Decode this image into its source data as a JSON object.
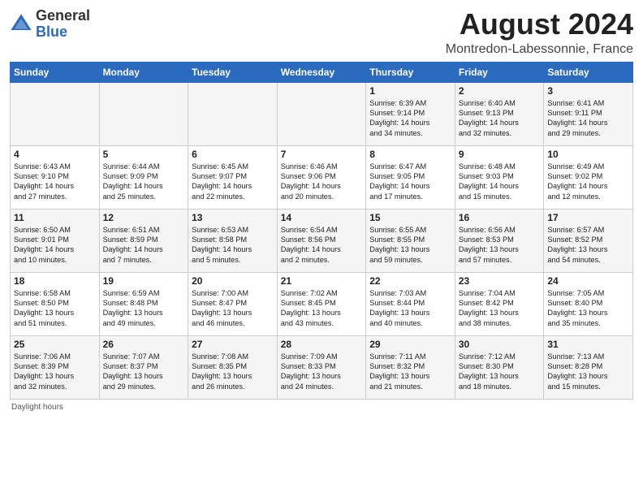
{
  "header": {
    "logo_general": "General",
    "logo_blue": "Blue",
    "title": "August 2024",
    "subtitle": "Montredon-Labessonnie, France"
  },
  "days_of_week": [
    "Sunday",
    "Monday",
    "Tuesday",
    "Wednesday",
    "Thursday",
    "Friday",
    "Saturday"
  ],
  "footer": {
    "note": "Daylight hours"
  },
  "weeks": [
    [
      {
        "day": "",
        "info": ""
      },
      {
        "day": "",
        "info": ""
      },
      {
        "day": "",
        "info": ""
      },
      {
        "day": "",
        "info": ""
      },
      {
        "day": "1",
        "info": "Sunrise: 6:39 AM\nSunset: 9:14 PM\nDaylight: 14 hours\nand 34 minutes."
      },
      {
        "day": "2",
        "info": "Sunrise: 6:40 AM\nSunset: 9:13 PM\nDaylight: 14 hours\nand 32 minutes."
      },
      {
        "day": "3",
        "info": "Sunrise: 6:41 AM\nSunset: 9:11 PM\nDaylight: 14 hours\nand 29 minutes."
      }
    ],
    [
      {
        "day": "4",
        "info": "Sunrise: 6:43 AM\nSunset: 9:10 PM\nDaylight: 14 hours\nand 27 minutes."
      },
      {
        "day": "5",
        "info": "Sunrise: 6:44 AM\nSunset: 9:09 PM\nDaylight: 14 hours\nand 25 minutes."
      },
      {
        "day": "6",
        "info": "Sunrise: 6:45 AM\nSunset: 9:07 PM\nDaylight: 14 hours\nand 22 minutes."
      },
      {
        "day": "7",
        "info": "Sunrise: 6:46 AM\nSunset: 9:06 PM\nDaylight: 14 hours\nand 20 minutes."
      },
      {
        "day": "8",
        "info": "Sunrise: 6:47 AM\nSunset: 9:05 PM\nDaylight: 14 hours\nand 17 minutes."
      },
      {
        "day": "9",
        "info": "Sunrise: 6:48 AM\nSunset: 9:03 PM\nDaylight: 14 hours\nand 15 minutes."
      },
      {
        "day": "10",
        "info": "Sunrise: 6:49 AM\nSunset: 9:02 PM\nDaylight: 14 hours\nand 12 minutes."
      }
    ],
    [
      {
        "day": "11",
        "info": "Sunrise: 6:50 AM\nSunset: 9:01 PM\nDaylight: 14 hours\nand 10 minutes."
      },
      {
        "day": "12",
        "info": "Sunrise: 6:51 AM\nSunset: 8:59 PM\nDaylight: 14 hours\nand 7 minutes."
      },
      {
        "day": "13",
        "info": "Sunrise: 6:53 AM\nSunset: 8:58 PM\nDaylight: 14 hours\nand 5 minutes."
      },
      {
        "day": "14",
        "info": "Sunrise: 6:54 AM\nSunset: 8:56 PM\nDaylight: 14 hours\nand 2 minutes."
      },
      {
        "day": "15",
        "info": "Sunrise: 6:55 AM\nSunset: 8:55 PM\nDaylight: 13 hours\nand 59 minutes."
      },
      {
        "day": "16",
        "info": "Sunrise: 6:56 AM\nSunset: 8:53 PM\nDaylight: 13 hours\nand 57 minutes."
      },
      {
        "day": "17",
        "info": "Sunrise: 6:57 AM\nSunset: 8:52 PM\nDaylight: 13 hours\nand 54 minutes."
      }
    ],
    [
      {
        "day": "18",
        "info": "Sunrise: 6:58 AM\nSunset: 8:50 PM\nDaylight: 13 hours\nand 51 minutes."
      },
      {
        "day": "19",
        "info": "Sunrise: 6:59 AM\nSunset: 8:48 PM\nDaylight: 13 hours\nand 49 minutes."
      },
      {
        "day": "20",
        "info": "Sunrise: 7:00 AM\nSunset: 8:47 PM\nDaylight: 13 hours\nand 46 minutes."
      },
      {
        "day": "21",
        "info": "Sunrise: 7:02 AM\nSunset: 8:45 PM\nDaylight: 13 hours\nand 43 minutes."
      },
      {
        "day": "22",
        "info": "Sunrise: 7:03 AM\nSunset: 8:44 PM\nDaylight: 13 hours\nand 40 minutes."
      },
      {
        "day": "23",
        "info": "Sunrise: 7:04 AM\nSunset: 8:42 PM\nDaylight: 13 hours\nand 38 minutes."
      },
      {
        "day": "24",
        "info": "Sunrise: 7:05 AM\nSunset: 8:40 PM\nDaylight: 13 hours\nand 35 minutes."
      }
    ],
    [
      {
        "day": "25",
        "info": "Sunrise: 7:06 AM\nSunset: 8:39 PM\nDaylight: 13 hours\nand 32 minutes."
      },
      {
        "day": "26",
        "info": "Sunrise: 7:07 AM\nSunset: 8:37 PM\nDaylight: 13 hours\nand 29 minutes."
      },
      {
        "day": "27",
        "info": "Sunrise: 7:08 AM\nSunset: 8:35 PM\nDaylight: 13 hours\nand 26 minutes."
      },
      {
        "day": "28",
        "info": "Sunrise: 7:09 AM\nSunset: 8:33 PM\nDaylight: 13 hours\nand 24 minutes."
      },
      {
        "day": "29",
        "info": "Sunrise: 7:11 AM\nSunset: 8:32 PM\nDaylight: 13 hours\nand 21 minutes."
      },
      {
        "day": "30",
        "info": "Sunrise: 7:12 AM\nSunset: 8:30 PM\nDaylight: 13 hours\nand 18 minutes."
      },
      {
        "day": "31",
        "info": "Sunrise: 7:13 AM\nSunset: 8:28 PM\nDaylight: 13 hours\nand 15 minutes."
      }
    ]
  ]
}
